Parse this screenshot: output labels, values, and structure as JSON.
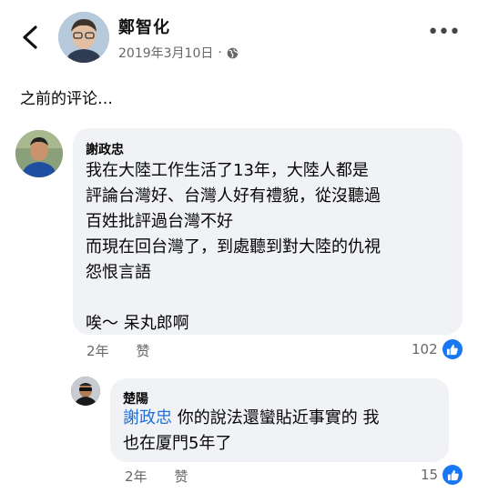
{
  "post": {
    "author": "鄭智化",
    "date": "2019年3月10日",
    "separator": "·"
  },
  "section_title": "之前的评论…",
  "comments": [
    {
      "name": "謝政忠",
      "text": "我在大陸工作生活了13年，大陸人都是\n評論台灣好、台灣人好有禮貌，從沒聽過\n百姓批評過台灣不好\n而現在回台灣了，到處聽到對大陸的仇視\n怨恨言語\n\n唉～ 呆丸郎啊",
      "time": "2年",
      "like_label": "赞",
      "reaction_count": "102"
    },
    {
      "name": "楚陽",
      "mention": "謝政忠",
      "text": " 你的說法還蠻貼近事實的 我\n也在厦門5年了",
      "time": "2年",
      "like_label": "赞",
      "reaction_count": "15"
    }
  ],
  "icons": {
    "back": "chevron-left-icon",
    "privacy": "globe-icon",
    "more": "more-dots-icon",
    "like": "thumbs-up-icon"
  },
  "colors": {
    "bubble": "#f0f2f5",
    "link": "#216fdb",
    "like": "#1877f2",
    "meta": "#65676b"
  }
}
